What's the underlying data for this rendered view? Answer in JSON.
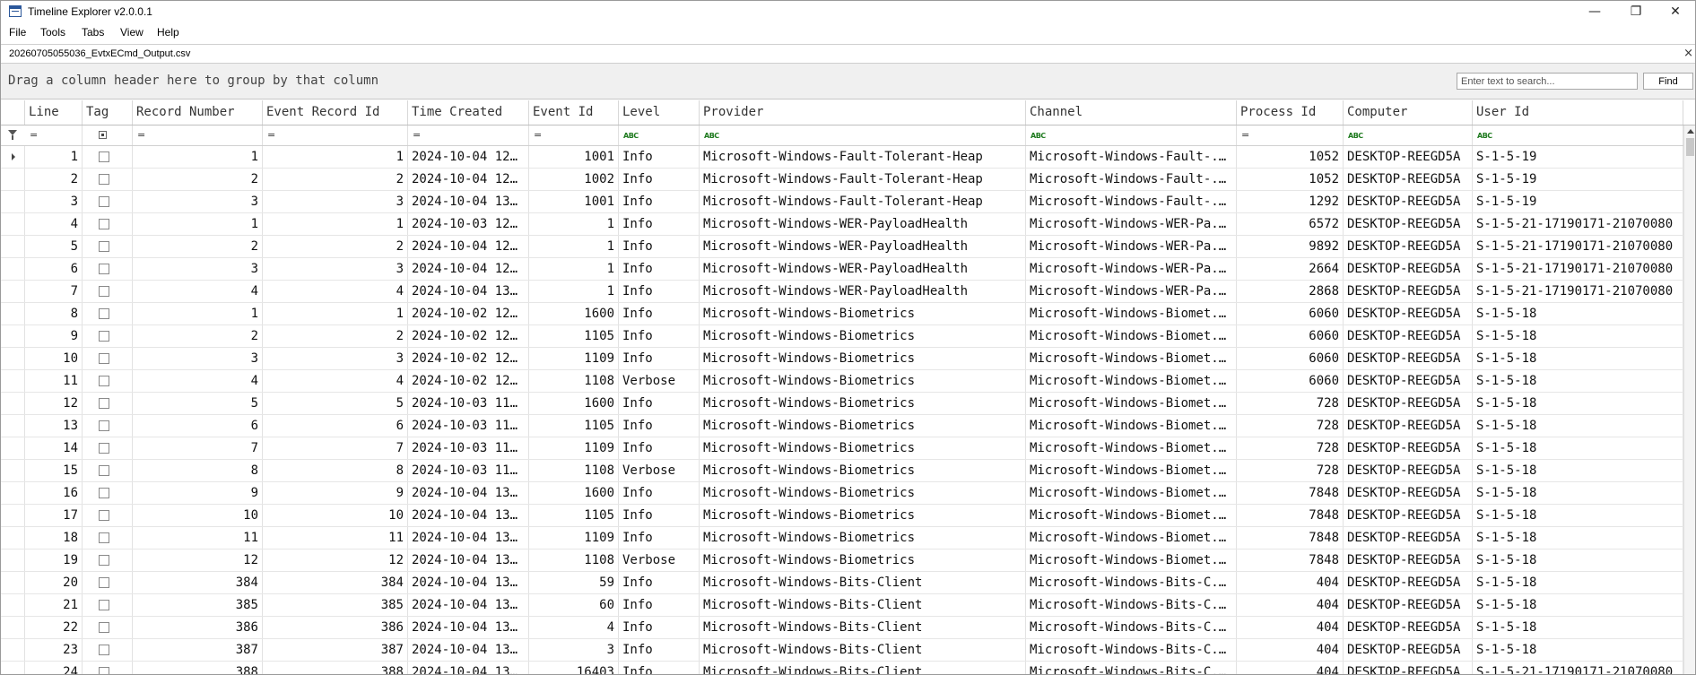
{
  "window": {
    "title": "Timeline Explorer v2.0.0.1",
    "controls": {
      "minimize": "—",
      "restore": "❐",
      "close": "✕"
    }
  },
  "menu": [
    "File",
    "Tools",
    "Tabs",
    "View",
    "Help"
  ],
  "file_tab": {
    "label": "20260705055036_EvtxECmd_Output.csv",
    "close": "×"
  },
  "group_panel": {
    "hint": "Drag a column header here to group by that column"
  },
  "search": {
    "placeholder": "Enter text to search...",
    "value": "",
    "button": "Find"
  },
  "icons": {
    "app": "app-window-icon",
    "filter": "funnel-filter-icon",
    "row_indicator": "current-row-arrow-icon",
    "abc_filter": "text-filter-abc-icon"
  },
  "columns": [
    "Line",
    "Tag",
    "Record Number",
    "Event Record Id",
    "Time Created",
    "Event Id",
    "Level",
    "Provider",
    "Channel",
    "Process Id",
    "Computer",
    "User Id"
  ],
  "filter_row": [
    "=",
    "",
    "=",
    "=",
    "=",
    "=",
    "ABC",
    "ABC",
    "ABC",
    "=",
    "ABC",
    "ABC"
  ],
  "rows": [
    [
      "1",
      "",
      "1",
      "1",
      "2024-10-04 12...",
      "1001",
      "Info",
      "Microsoft-Windows-Fault-Tolerant-Heap",
      "Microsoft-Windows-Fault-...",
      "1052",
      "DESKTOP-REEGD5A",
      "S-1-5-19"
    ],
    [
      "2",
      "",
      "2",
      "2",
      "2024-10-04 12...",
      "1002",
      "Info",
      "Microsoft-Windows-Fault-Tolerant-Heap",
      "Microsoft-Windows-Fault-...",
      "1052",
      "DESKTOP-REEGD5A",
      "S-1-5-19"
    ],
    [
      "3",
      "",
      "3",
      "3",
      "2024-10-04 13...",
      "1001",
      "Info",
      "Microsoft-Windows-Fault-Tolerant-Heap",
      "Microsoft-Windows-Fault-...",
      "1292",
      "DESKTOP-REEGD5A",
      "S-1-5-19"
    ],
    [
      "4",
      "",
      "1",
      "1",
      "2024-10-03 12...",
      "1",
      "Info",
      "Microsoft-Windows-WER-PayloadHealth",
      "Microsoft-Windows-WER-Pa...",
      "6572",
      "DESKTOP-REEGD5A",
      "S-1-5-21-17190171-21070080"
    ],
    [
      "5",
      "",
      "2",
      "2",
      "2024-10-04 12...",
      "1",
      "Info",
      "Microsoft-Windows-WER-PayloadHealth",
      "Microsoft-Windows-WER-Pa...",
      "9892",
      "DESKTOP-REEGD5A",
      "S-1-5-21-17190171-21070080"
    ],
    [
      "6",
      "",
      "3",
      "3",
      "2024-10-04 12...",
      "1",
      "Info",
      "Microsoft-Windows-WER-PayloadHealth",
      "Microsoft-Windows-WER-Pa...",
      "2664",
      "DESKTOP-REEGD5A",
      "S-1-5-21-17190171-21070080"
    ],
    [
      "7",
      "",
      "4",
      "4",
      "2024-10-04 13...",
      "1",
      "Info",
      "Microsoft-Windows-WER-PayloadHealth",
      "Microsoft-Windows-WER-Pa...",
      "2868",
      "DESKTOP-REEGD5A",
      "S-1-5-21-17190171-21070080"
    ],
    [
      "8",
      "",
      "1",
      "1",
      "2024-10-02 12...",
      "1600",
      "Info",
      "Microsoft-Windows-Biometrics",
      "Microsoft-Windows-Biomet...",
      "6060",
      "DESKTOP-REEGD5A",
      "S-1-5-18"
    ],
    [
      "9",
      "",
      "2",
      "2",
      "2024-10-02 12...",
      "1105",
      "Info",
      "Microsoft-Windows-Biometrics",
      "Microsoft-Windows-Biomet...",
      "6060",
      "DESKTOP-REEGD5A",
      "S-1-5-18"
    ],
    [
      "10",
      "",
      "3",
      "3",
      "2024-10-02 12...",
      "1109",
      "Info",
      "Microsoft-Windows-Biometrics",
      "Microsoft-Windows-Biomet...",
      "6060",
      "DESKTOP-REEGD5A",
      "S-1-5-18"
    ],
    [
      "11",
      "",
      "4",
      "4",
      "2024-10-02 12...",
      "1108",
      "Verbose",
      "Microsoft-Windows-Biometrics",
      "Microsoft-Windows-Biomet...",
      "6060",
      "DESKTOP-REEGD5A",
      "S-1-5-18"
    ],
    [
      "12",
      "",
      "5",
      "5",
      "2024-10-03 11...",
      "1600",
      "Info",
      "Microsoft-Windows-Biometrics",
      "Microsoft-Windows-Biomet...",
      "728",
      "DESKTOP-REEGD5A",
      "S-1-5-18"
    ],
    [
      "13",
      "",
      "6",
      "6",
      "2024-10-03 11...",
      "1105",
      "Info",
      "Microsoft-Windows-Biometrics",
      "Microsoft-Windows-Biomet...",
      "728",
      "DESKTOP-REEGD5A",
      "S-1-5-18"
    ],
    [
      "14",
      "",
      "7",
      "7",
      "2024-10-03 11...",
      "1109",
      "Info",
      "Microsoft-Windows-Biometrics",
      "Microsoft-Windows-Biomet...",
      "728",
      "DESKTOP-REEGD5A",
      "S-1-5-18"
    ],
    [
      "15",
      "",
      "8",
      "8",
      "2024-10-03 11...",
      "1108",
      "Verbose",
      "Microsoft-Windows-Biometrics",
      "Microsoft-Windows-Biomet...",
      "728",
      "DESKTOP-REEGD5A",
      "S-1-5-18"
    ],
    [
      "16",
      "",
      "9",
      "9",
      "2024-10-04 13...",
      "1600",
      "Info",
      "Microsoft-Windows-Biometrics",
      "Microsoft-Windows-Biomet...",
      "7848",
      "DESKTOP-REEGD5A",
      "S-1-5-18"
    ],
    [
      "17",
      "",
      "10",
      "10",
      "2024-10-04 13...",
      "1105",
      "Info",
      "Microsoft-Windows-Biometrics",
      "Microsoft-Windows-Biomet...",
      "7848",
      "DESKTOP-REEGD5A",
      "S-1-5-18"
    ],
    [
      "18",
      "",
      "11",
      "11",
      "2024-10-04 13...",
      "1109",
      "Info",
      "Microsoft-Windows-Biometrics",
      "Microsoft-Windows-Biomet...",
      "7848",
      "DESKTOP-REEGD5A",
      "S-1-5-18"
    ],
    [
      "19",
      "",
      "12",
      "12",
      "2024-10-04 13...",
      "1108",
      "Verbose",
      "Microsoft-Windows-Biometrics",
      "Microsoft-Windows-Biomet...",
      "7848",
      "DESKTOP-REEGD5A",
      "S-1-5-18"
    ],
    [
      "20",
      "",
      "384",
      "384",
      "2024-10-04 13...",
      "59",
      "Info",
      "Microsoft-Windows-Bits-Client",
      "Microsoft-Windows-Bits-C...",
      "404",
      "DESKTOP-REEGD5A",
      "S-1-5-18"
    ],
    [
      "21",
      "",
      "385",
      "385",
      "2024-10-04 13...",
      "60",
      "Info",
      "Microsoft-Windows-Bits-Client",
      "Microsoft-Windows-Bits-C...",
      "404",
      "DESKTOP-REEGD5A",
      "S-1-5-18"
    ],
    [
      "22",
      "",
      "386",
      "386",
      "2024-10-04 13...",
      "4",
      "Info",
      "Microsoft-Windows-Bits-Client",
      "Microsoft-Windows-Bits-C...",
      "404",
      "DESKTOP-REEGD5A",
      "S-1-5-18"
    ],
    [
      "23",
      "",
      "387",
      "387",
      "2024-10-04 13...",
      "3",
      "Info",
      "Microsoft-Windows-Bits-Client",
      "Microsoft-Windows-Bits-C...",
      "404",
      "DESKTOP-REEGD5A",
      "S-1-5-18"
    ],
    [
      "24",
      "",
      "388",
      "388",
      "2024-10-04 13...",
      "16403",
      "Info",
      "Microsoft-Windows-Bits-Client",
      "Microsoft-Windows-Bits-C...",
      "404",
      "DESKTOP-REEGD5A",
      "S-1-5-21-17190171-21070080"
    ]
  ]
}
